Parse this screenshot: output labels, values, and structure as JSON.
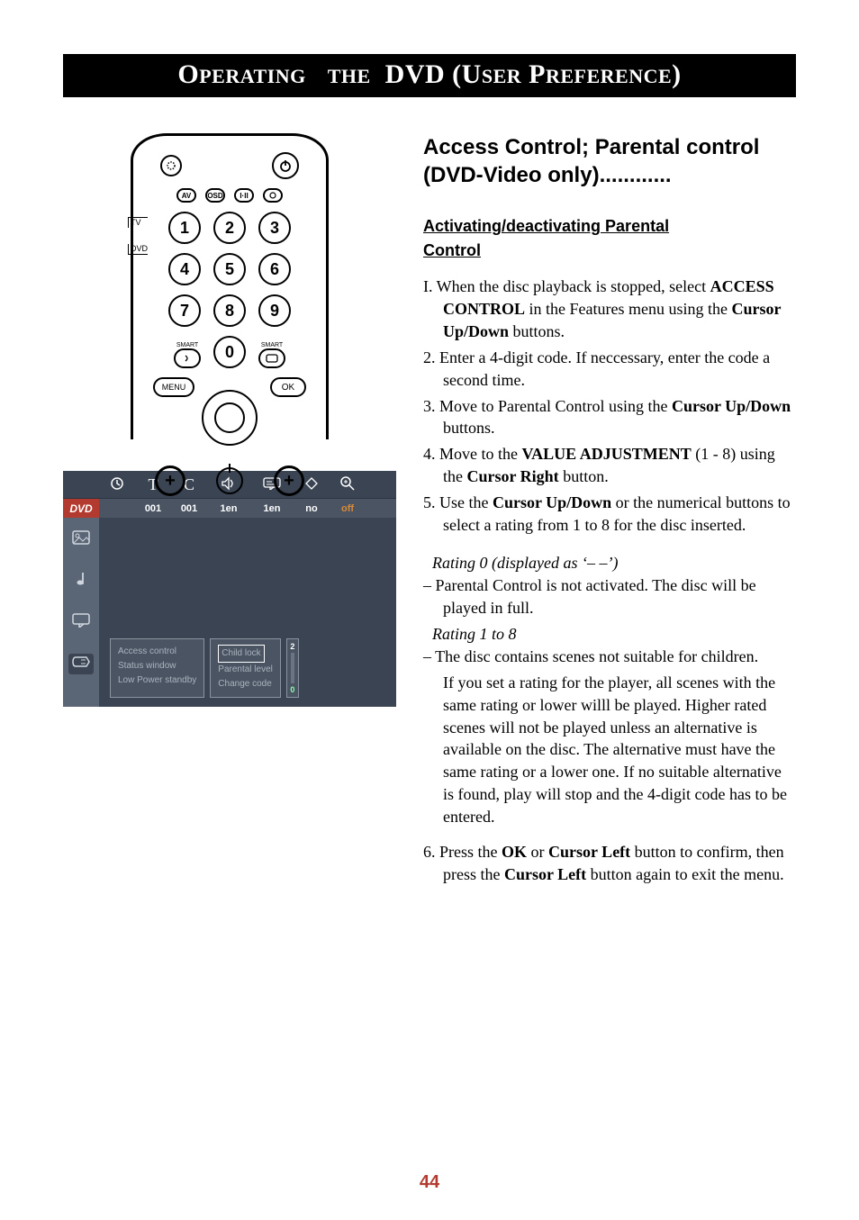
{
  "header": {
    "title_html": "OPERATING  THE  DVD (USER PREFERENCE)"
  },
  "remote": {
    "small_row": [
      "AV",
      "OSD",
      "I·II",
      "⏺"
    ],
    "digits": [
      "1",
      "2",
      "3",
      "4",
      "5",
      "6",
      "7",
      "8",
      "9",
      "0"
    ],
    "smart_left": "SMART",
    "smart_right": "SMART",
    "menu": "MENU",
    "ok": "OK",
    "plus": "+",
    "side_tv": "TV",
    "side_dvd": "DVD"
  },
  "osd": {
    "header_icons": [
      "⏲",
      "T",
      "C",
      "🔊",
      "💬",
      "⬨",
      "🔍"
    ],
    "sub": {
      "logo": "DVD",
      "t": "001",
      "c": "001",
      "aud": "1en",
      "sub": "1en",
      "ang": "no",
      "zoom": "off"
    },
    "panel_left": [
      "Access control",
      "Status window",
      "Low Power standby"
    ],
    "panel_right": [
      "Child lock",
      "Parental level",
      "Change code"
    ],
    "slider_top": "2",
    "slider_bottom": "0"
  },
  "content": {
    "section_title_line1": "Access Control; Parental control",
    "section_title_line2": "(DVD-Video only)............",
    "subheading_line1": "Activating/deactivating  Parental",
    "subheading_line2": "Control",
    "steps": [
      "I.  When the disc playback is stopped, select <b>ACCESS CONTROL</b> in the Features menu using the <b>Cursor Up/Down</b> buttons.",
      "2. Enter a 4-digit code. If neccessary, enter the code a second time.",
      "3. Move to Parental Control using the <b>Cursor Up/Down</b> buttons.",
      "4. Move to the <b>VALUE ADJUSTMENT</b> (1 - 8) using the <b>Cursor Right</b> button.",
      "5. Use the <b>Cursor Up/Down</b> or the numerical buttons to select a rating from 1 to 8 for the disc inserted."
    ],
    "rating0_label": "Rating 0 (displayed as ‘– –’)",
    "rating0_text": "–  Parental Control is not activated. The disc will be played in full.",
    "rating18_label": "Rating 1 to 8",
    "rating18_text": "–  The disc contains scenes not suitable for children.",
    "rating18_para": "If you set a rating for the player, all scenes with the same rating or lower willl be played. Higher rated scenes will not be played unless an alternative is available on the disc. The alternative must have the same rating or a lower one. If no suitable alternative is found, play will stop and the 4-digit code has to be entered.",
    "step6": "6. Press the <b>OK</b> or <b>Cursor Left</b> button to confirm, then press the <b>Cursor Left</b> button again to exit the menu."
  },
  "page_number": "44"
}
